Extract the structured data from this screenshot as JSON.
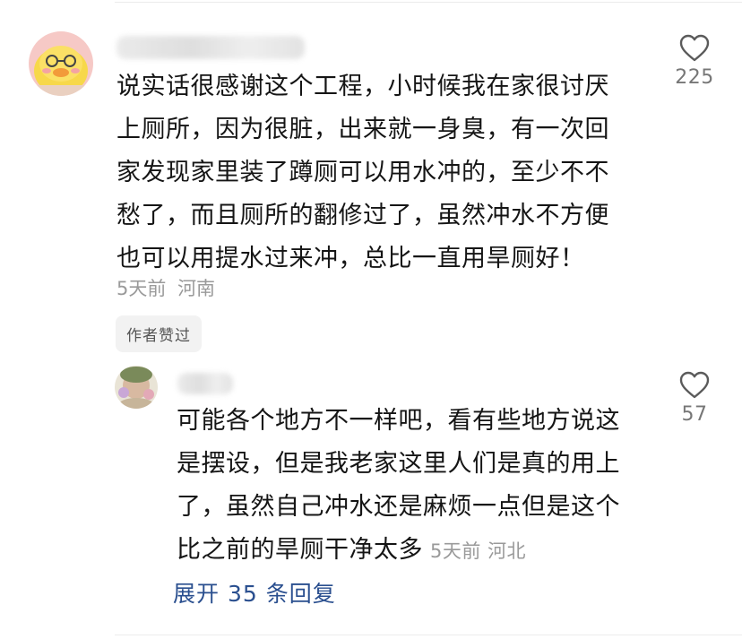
{
  "comments": [
    {
      "text": "说实话很感谢这个工程，小时候我在家很讨厌\n上厕所，因为很脏，出来就一身臭，有一次回\n家发现家里装了蹲厕可以用水冲的，至少不不\n愁了，而且厕所的翻修过了，虽然冲水不方便\n也可以用提水过来冲，总比一直用旱厕好！",
      "time": "5天前",
      "location": "河南",
      "likes": "225",
      "author_badge": "作者赞过"
    }
  ],
  "reply": {
    "text": "可能各个地方不一样吧，看有些地方说这\n是摆设，但是我老家这里人们是真的用上\n了，虽然自己冲水还是麻烦一点但是这个\n比之前的旱厕干净太多",
    "time": "5天前",
    "location": "河北",
    "likes": "57"
  },
  "expand_replies": {
    "label": "展开 35 条回复"
  },
  "icons": {
    "like": "heart-outline-icon"
  }
}
